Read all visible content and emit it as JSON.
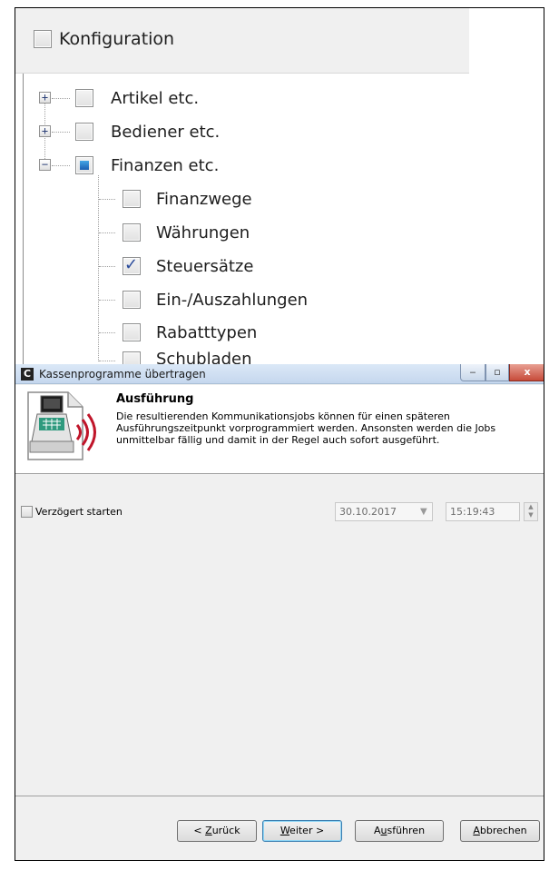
{
  "tree": {
    "root_label": "Konfiguration",
    "items": [
      {
        "label": "Artikel etc.",
        "expander": "+",
        "state": "unchecked"
      },
      {
        "label": "Bediener etc.",
        "expander": "+",
        "state": "unchecked"
      },
      {
        "label": "Finanzen etc.",
        "expander": "−",
        "state": "partial"
      }
    ],
    "children": [
      {
        "label": "Finanzwege",
        "state": "unchecked"
      },
      {
        "label": "Währungen",
        "state": "unchecked"
      },
      {
        "label": "Steuersätze",
        "state": "checked"
      },
      {
        "label": "Ein-/Auszahlungen",
        "state": "unchecked"
      },
      {
        "label": "Rabatttypen",
        "state": "unchecked"
      },
      {
        "label": "Schubladen",
        "state": "unchecked"
      }
    ]
  },
  "dialog": {
    "title": "Kassenprogramme übertragen",
    "app_icon_glyph": "C",
    "window_buttons": {
      "minimize": "‒",
      "maximize": "▫",
      "close": "x"
    },
    "header": {
      "title": "Ausführung",
      "description": "Die resultierenden Kommunikationsjobs können für einen späteren Ausführungszeitpunkt vorprogrammiert werden. Ansonsten werden die Jobs unmittelbar fällig und damit in der Regel auch sofort ausgeführt."
    },
    "delay": {
      "label": "Verzögert starten",
      "checked": false,
      "date": "30.10.2017",
      "time": "15:19:43"
    },
    "buttons": {
      "back": {
        "prefix": "< ",
        "accel": "Z",
        "rest": "urück"
      },
      "next": {
        "prefix": "",
        "accel": "W",
        "rest": "eiter >"
      },
      "run": {
        "prefix": "A",
        "accel": "u",
        "rest": "sführen"
      },
      "cancel": {
        "prefix": "",
        "accel": "A",
        "rest": "bbrechen"
      }
    }
  },
  "colors": {
    "accent": "#1a5eb2",
    "titlebar": "#c5d7ee",
    "close_button": "#c74b3a",
    "signal_red": "#c0152a",
    "keypad_green": "#2f9a7e"
  }
}
